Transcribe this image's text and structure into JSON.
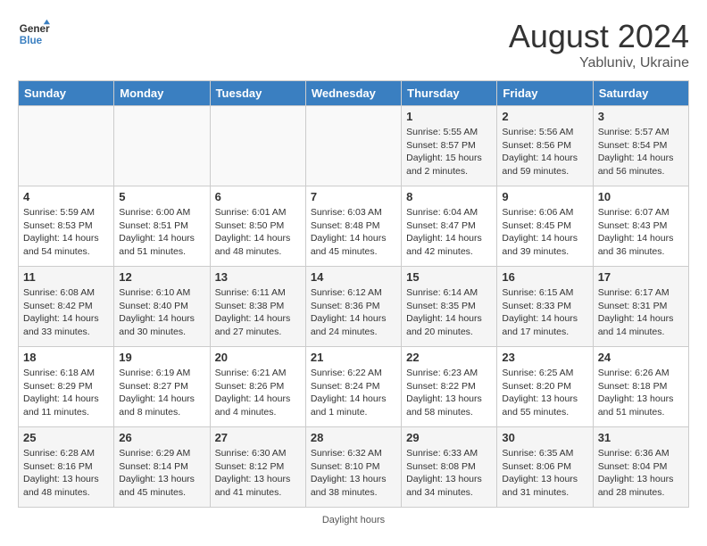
{
  "header": {
    "logo_text_general": "General",
    "logo_text_blue": "Blue",
    "month_year": "August 2024",
    "location": "Yabluniv, Ukraine"
  },
  "days_of_week": [
    "Sunday",
    "Monday",
    "Tuesday",
    "Wednesday",
    "Thursday",
    "Friday",
    "Saturday"
  ],
  "weeks": [
    [
      {
        "day": "",
        "info": ""
      },
      {
        "day": "",
        "info": ""
      },
      {
        "day": "",
        "info": ""
      },
      {
        "day": "",
        "info": ""
      },
      {
        "day": "1",
        "info": "Sunrise: 5:55 AM\nSunset: 8:57 PM\nDaylight: 15 hours and 2 minutes."
      },
      {
        "day": "2",
        "info": "Sunrise: 5:56 AM\nSunset: 8:56 PM\nDaylight: 14 hours and 59 minutes."
      },
      {
        "day": "3",
        "info": "Sunrise: 5:57 AM\nSunset: 8:54 PM\nDaylight: 14 hours and 56 minutes."
      }
    ],
    [
      {
        "day": "4",
        "info": "Sunrise: 5:59 AM\nSunset: 8:53 PM\nDaylight: 14 hours and 54 minutes."
      },
      {
        "day": "5",
        "info": "Sunrise: 6:00 AM\nSunset: 8:51 PM\nDaylight: 14 hours and 51 minutes."
      },
      {
        "day": "6",
        "info": "Sunrise: 6:01 AM\nSunset: 8:50 PM\nDaylight: 14 hours and 48 minutes."
      },
      {
        "day": "7",
        "info": "Sunrise: 6:03 AM\nSunset: 8:48 PM\nDaylight: 14 hours and 45 minutes."
      },
      {
        "day": "8",
        "info": "Sunrise: 6:04 AM\nSunset: 8:47 PM\nDaylight: 14 hours and 42 minutes."
      },
      {
        "day": "9",
        "info": "Sunrise: 6:06 AM\nSunset: 8:45 PM\nDaylight: 14 hours and 39 minutes."
      },
      {
        "day": "10",
        "info": "Sunrise: 6:07 AM\nSunset: 8:43 PM\nDaylight: 14 hours and 36 minutes."
      }
    ],
    [
      {
        "day": "11",
        "info": "Sunrise: 6:08 AM\nSunset: 8:42 PM\nDaylight: 14 hours and 33 minutes."
      },
      {
        "day": "12",
        "info": "Sunrise: 6:10 AM\nSunset: 8:40 PM\nDaylight: 14 hours and 30 minutes."
      },
      {
        "day": "13",
        "info": "Sunrise: 6:11 AM\nSunset: 8:38 PM\nDaylight: 14 hours and 27 minutes."
      },
      {
        "day": "14",
        "info": "Sunrise: 6:12 AM\nSunset: 8:36 PM\nDaylight: 14 hours and 24 minutes."
      },
      {
        "day": "15",
        "info": "Sunrise: 6:14 AM\nSunset: 8:35 PM\nDaylight: 14 hours and 20 minutes."
      },
      {
        "day": "16",
        "info": "Sunrise: 6:15 AM\nSunset: 8:33 PM\nDaylight: 14 hours and 17 minutes."
      },
      {
        "day": "17",
        "info": "Sunrise: 6:17 AM\nSunset: 8:31 PM\nDaylight: 14 hours and 14 minutes."
      }
    ],
    [
      {
        "day": "18",
        "info": "Sunrise: 6:18 AM\nSunset: 8:29 PM\nDaylight: 14 hours and 11 minutes."
      },
      {
        "day": "19",
        "info": "Sunrise: 6:19 AM\nSunset: 8:27 PM\nDaylight: 14 hours and 8 minutes."
      },
      {
        "day": "20",
        "info": "Sunrise: 6:21 AM\nSunset: 8:26 PM\nDaylight: 14 hours and 4 minutes."
      },
      {
        "day": "21",
        "info": "Sunrise: 6:22 AM\nSunset: 8:24 PM\nDaylight: 14 hours and 1 minute."
      },
      {
        "day": "22",
        "info": "Sunrise: 6:23 AM\nSunset: 8:22 PM\nDaylight: 13 hours and 58 minutes."
      },
      {
        "day": "23",
        "info": "Sunrise: 6:25 AM\nSunset: 8:20 PM\nDaylight: 13 hours and 55 minutes."
      },
      {
        "day": "24",
        "info": "Sunrise: 6:26 AM\nSunset: 8:18 PM\nDaylight: 13 hours and 51 minutes."
      }
    ],
    [
      {
        "day": "25",
        "info": "Sunrise: 6:28 AM\nSunset: 8:16 PM\nDaylight: 13 hours and 48 minutes."
      },
      {
        "day": "26",
        "info": "Sunrise: 6:29 AM\nSunset: 8:14 PM\nDaylight: 13 hours and 45 minutes."
      },
      {
        "day": "27",
        "info": "Sunrise: 6:30 AM\nSunset: 8:12 PM\nDaylight: 13 hours and 41 minutes."
      },
      {
        "day": "28",
        "info": "Sunrise: 6:32 AM\nSunset: 8:10 PM\nDaylight: 13 hours and 38 minutes."
      },
      {
        "day": "29",
        "info": "Sunrise: 6:33 AM\nSunset: 8:08 PM\nDaylight: 13 hours and 34 minutes."
      },
      {
        "day": "30",
        "info": "Sunrise: 6:35 AM\nSunset: 8:06 PM\nDaylight: 13 hours and 31 minutes."
      },
      {
        "day": "31",
        "info": "Sunrise: 6:36 AM\nSunset: 8:04 PM\nDaylight: 13 hours and 28 minutes."
      }
    ]
  ],
  "footer": {
    "daylight_hours_label": "Daylight hours"
  }
}
